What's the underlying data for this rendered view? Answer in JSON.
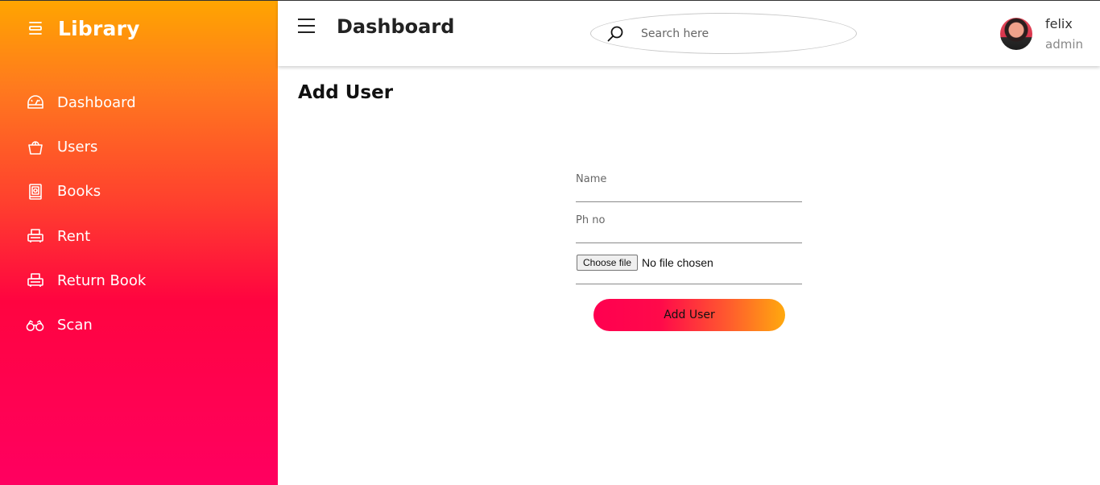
{
  "sidebar": {
    "brand": {
      "icon": "list-lines-icon",
      "title": "Library"
    },
    "items": [
      {
        "label": "Dashboard",
        "icon": "dashboard-icon"
      },
      {
        "label": "Users",
        "icon": "users-icon"
      },
      {
        "label": "Books",
        "icon": "book-icon"
      },
      {
        "label": "Rent",
        "icon": "printer-icon"
      },
      {
        "label": "Return Book",
        "icon": "printer-icon"
      },
      {
        "label": "Scan",
        "icon": "binoculars-icon"
      }
    ]
  },
  "header": {
    "title": "Dashboard",
    "search": {
      "placeholder": "Search here",
      "value": ""
    },
    "user": {
      "name": "felix",
      "role": "admin"
    }
  },
  "main": {
    "title": "Add User",
    "form": {
      "name": {
        "placeholder": "Name",
        "value": ""
      },
      "phone": {
        "placeholder": "Ph no",
        "value": ""
      },
      "file": {
        "button_label": "Choose file",
        "status": "No file chosen"
      },
      "submit_label": "Add User"
    }
  },
  "colors": {
    "sidebar_top": "#ffa500",
    "sidebar_bottom": "#ff0060",
    "button_start": "#ff0050",
    "button_end": "#ffa90e"
  }
}
